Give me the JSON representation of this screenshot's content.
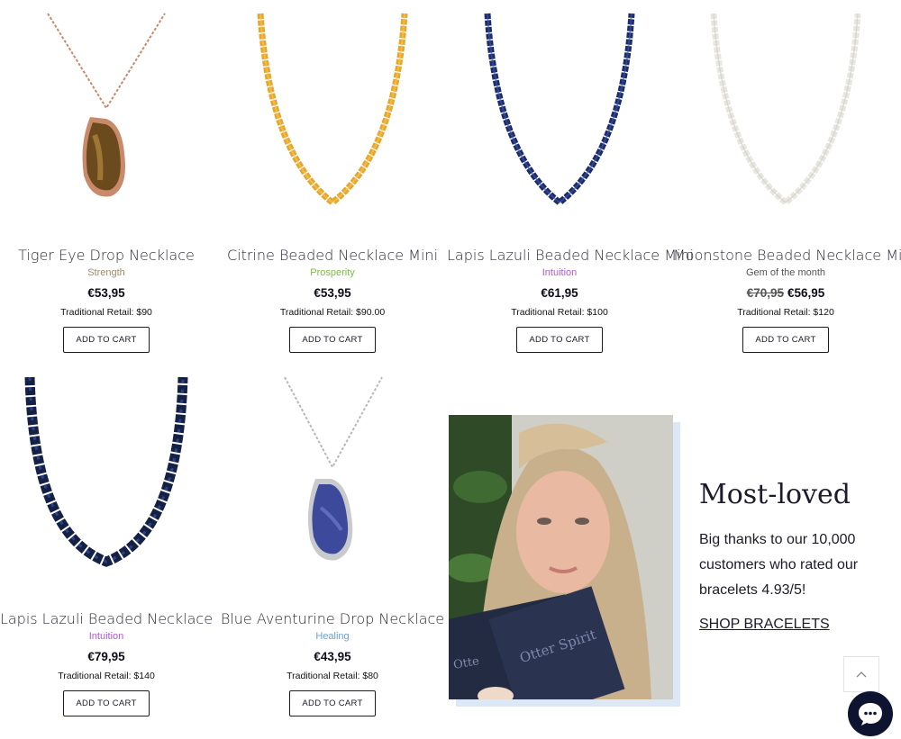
{
  "products": [
    {
      "title": "Tiger Eye Drop Necklace",
      "tag": "Strength",
      "tag_color": "#a08a66",
      "price": "€53,95",
      "old_price": "",
      "retail": "Traditional Retail: $90",
      "cart": "ADD TO CART"
    },
    {
      "title": "Citrine Beaded Necklace Mini",
      "tag": "Prosperity",
      "tag_color": "#7dbb4a",
      "price": "€53,95",
      "old_price": "",
      "retail": "Traditional Retail: $90.00",
      "cart": "ADD TO CART"
    },
    {
      "title": "Lapis Lazuli Beaded Necklace Mini",
      "tag": "Intuition",
      "tag_color": "#b05ad0",
      "price": "€61,95",
      "old_price": "",
      "retail": "Traditional Retail: $100",
      "cart": "ADD TO CART"
    },
    {
      "title": "Moonstone Beaded Necklace Mini",
      "tag": "Gem of the month",
      "tag_color": "#555555",
      "price": "€56,95",
      "old_price": "€70,95",
      "retail": "Traditional Retail: $120",
      "cart": "ADD TO CART"
    },
    {
      "title": "Lapis Lazuli Beaded Necklace",
      "tag": "Intuition",
      "tag_color": "#b05ad0",
      "price": "€79,95",
      "old_price": "",
      "retail": "Traditional Retail: $140",
      "cart": "ADD TO CART"
    },
    {
      "title": "Blue Aventurine Drop Necklace",
      "tag": "Healing",
      "tag_color": "#6aa0d8",
      "price": "€43,95",
      "old_price": "",
      "retail": "Traditional Retail: $80",
      "cart": "ADD TO CART"
    }
  ],
  "promo": {
    "title": "Most-loved",
    "text": "Big thanks to our 10,000 customers who rated our bracelets 4.93/5!",
    "link": "SHOP BRACELETS",
    "box_text_1": "Otter Spirit",
    "box_text_2": "Otte"
  },
  "icons": {
    "scroll_top": "chevron-up-icon",
    "chat": "chat-bubble-icon"
  }
}
